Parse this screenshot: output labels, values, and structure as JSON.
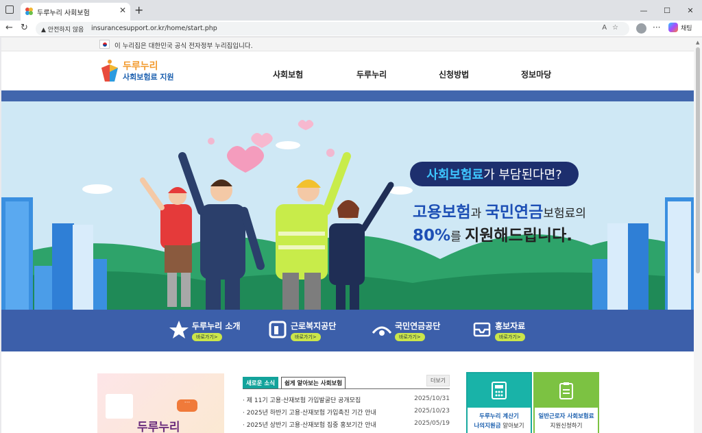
{
  "browser": {
    "tab_title": "두루누리 사회보험",
    "tab_close": "✕",
    "new_tab": "+",
    "security_label": "안전하지 않음",
    "url": "insurancesupport.or.kr/home/start.php",
    "copilot_label": "채팅",
    "window_buttons": [
      "—",
      "☐",
      "✕"
    ]
  },
  "gov_notice": "이 누리집은 대한민국 공식 전자정부 누리집입니다.",
  "header": {
    "logo_line1": "두루누리",
    "logo_line2": "사회보험료 지원",
    "nav": [
      "사회보험",
      "두루누리",
      "신청방법",
      "정보마당"
    ]
  },
  "hero": {
    "pill_highlight": "사회보험료",
    "pill_rest": "가 부담된다면?",
    "line1_a": "고용보험",
    "line1_b": "과 ",
    "line1_c": "국민연금",
    "line1_d": "보험료의",
    "line2_a": "80%",
    "line2_b": "를 ",
    "line2_c": "지원해드립니다."
  },
  "quick_links": [
    {
      "label": "두루누리 소개",
      "button": "바로가기>",
      "icon": "star-icon"
    },
    {
      "label": "근로복지공단",
      "button": "바로가기>",
      "icon": "comwel-logo-icon"
    },
    {
      "label": "국민연금공단",
      "button": "바로가기>",
      "icon": "nps-logo-icon"
    },
    {
      "label": "홍보자료",
      "button": "바로가기>",
      "icon": "inbox-icon"
    }
  ],
  "promo": {
    "title": "두루누리",
    "bubble": "···"
  },
  "news": {
    "tab_active": "새로운 소식",
    "tab_other": "쉽게 알아보는 사회보험",
    "more": "더보기",
    "items": [
      {
        "title": "· 제 11기 고용·산재보험 가입발굴단 공개모집",
        "date": "2025/10/31"
      },
      {
        "title": "· 2025년 하반기 고용·산재보험 가입촉진 기간 안내",
        "date": "2025/10/23"
      },
      {
        "title": "· 2025년 상반기 고용·산재보험 집중 홍보기간 안내",
        "date": "2025/05/19"
      }
    ]
  },
  "services": [
    {
      "line1": "두루누리 계산기",
      "line2_a": "나의지원금",
      "line2_b": " 알아보기",
      "color": "#19b3a8",
      "icon": "calculator-icon"
    },
    {
      "line1": "일반근로자 사회보험료",
      "line2": "지원신청하기",
      "color": "#7cc242",
      "icon": "clipboard-icon"
    }
  ],
  "colors": {
    "brand_blue": "#3c5faa",
    "accent_teal": "#13a39b",
    "hero_bg": "#cfe8f5"
  }
}
